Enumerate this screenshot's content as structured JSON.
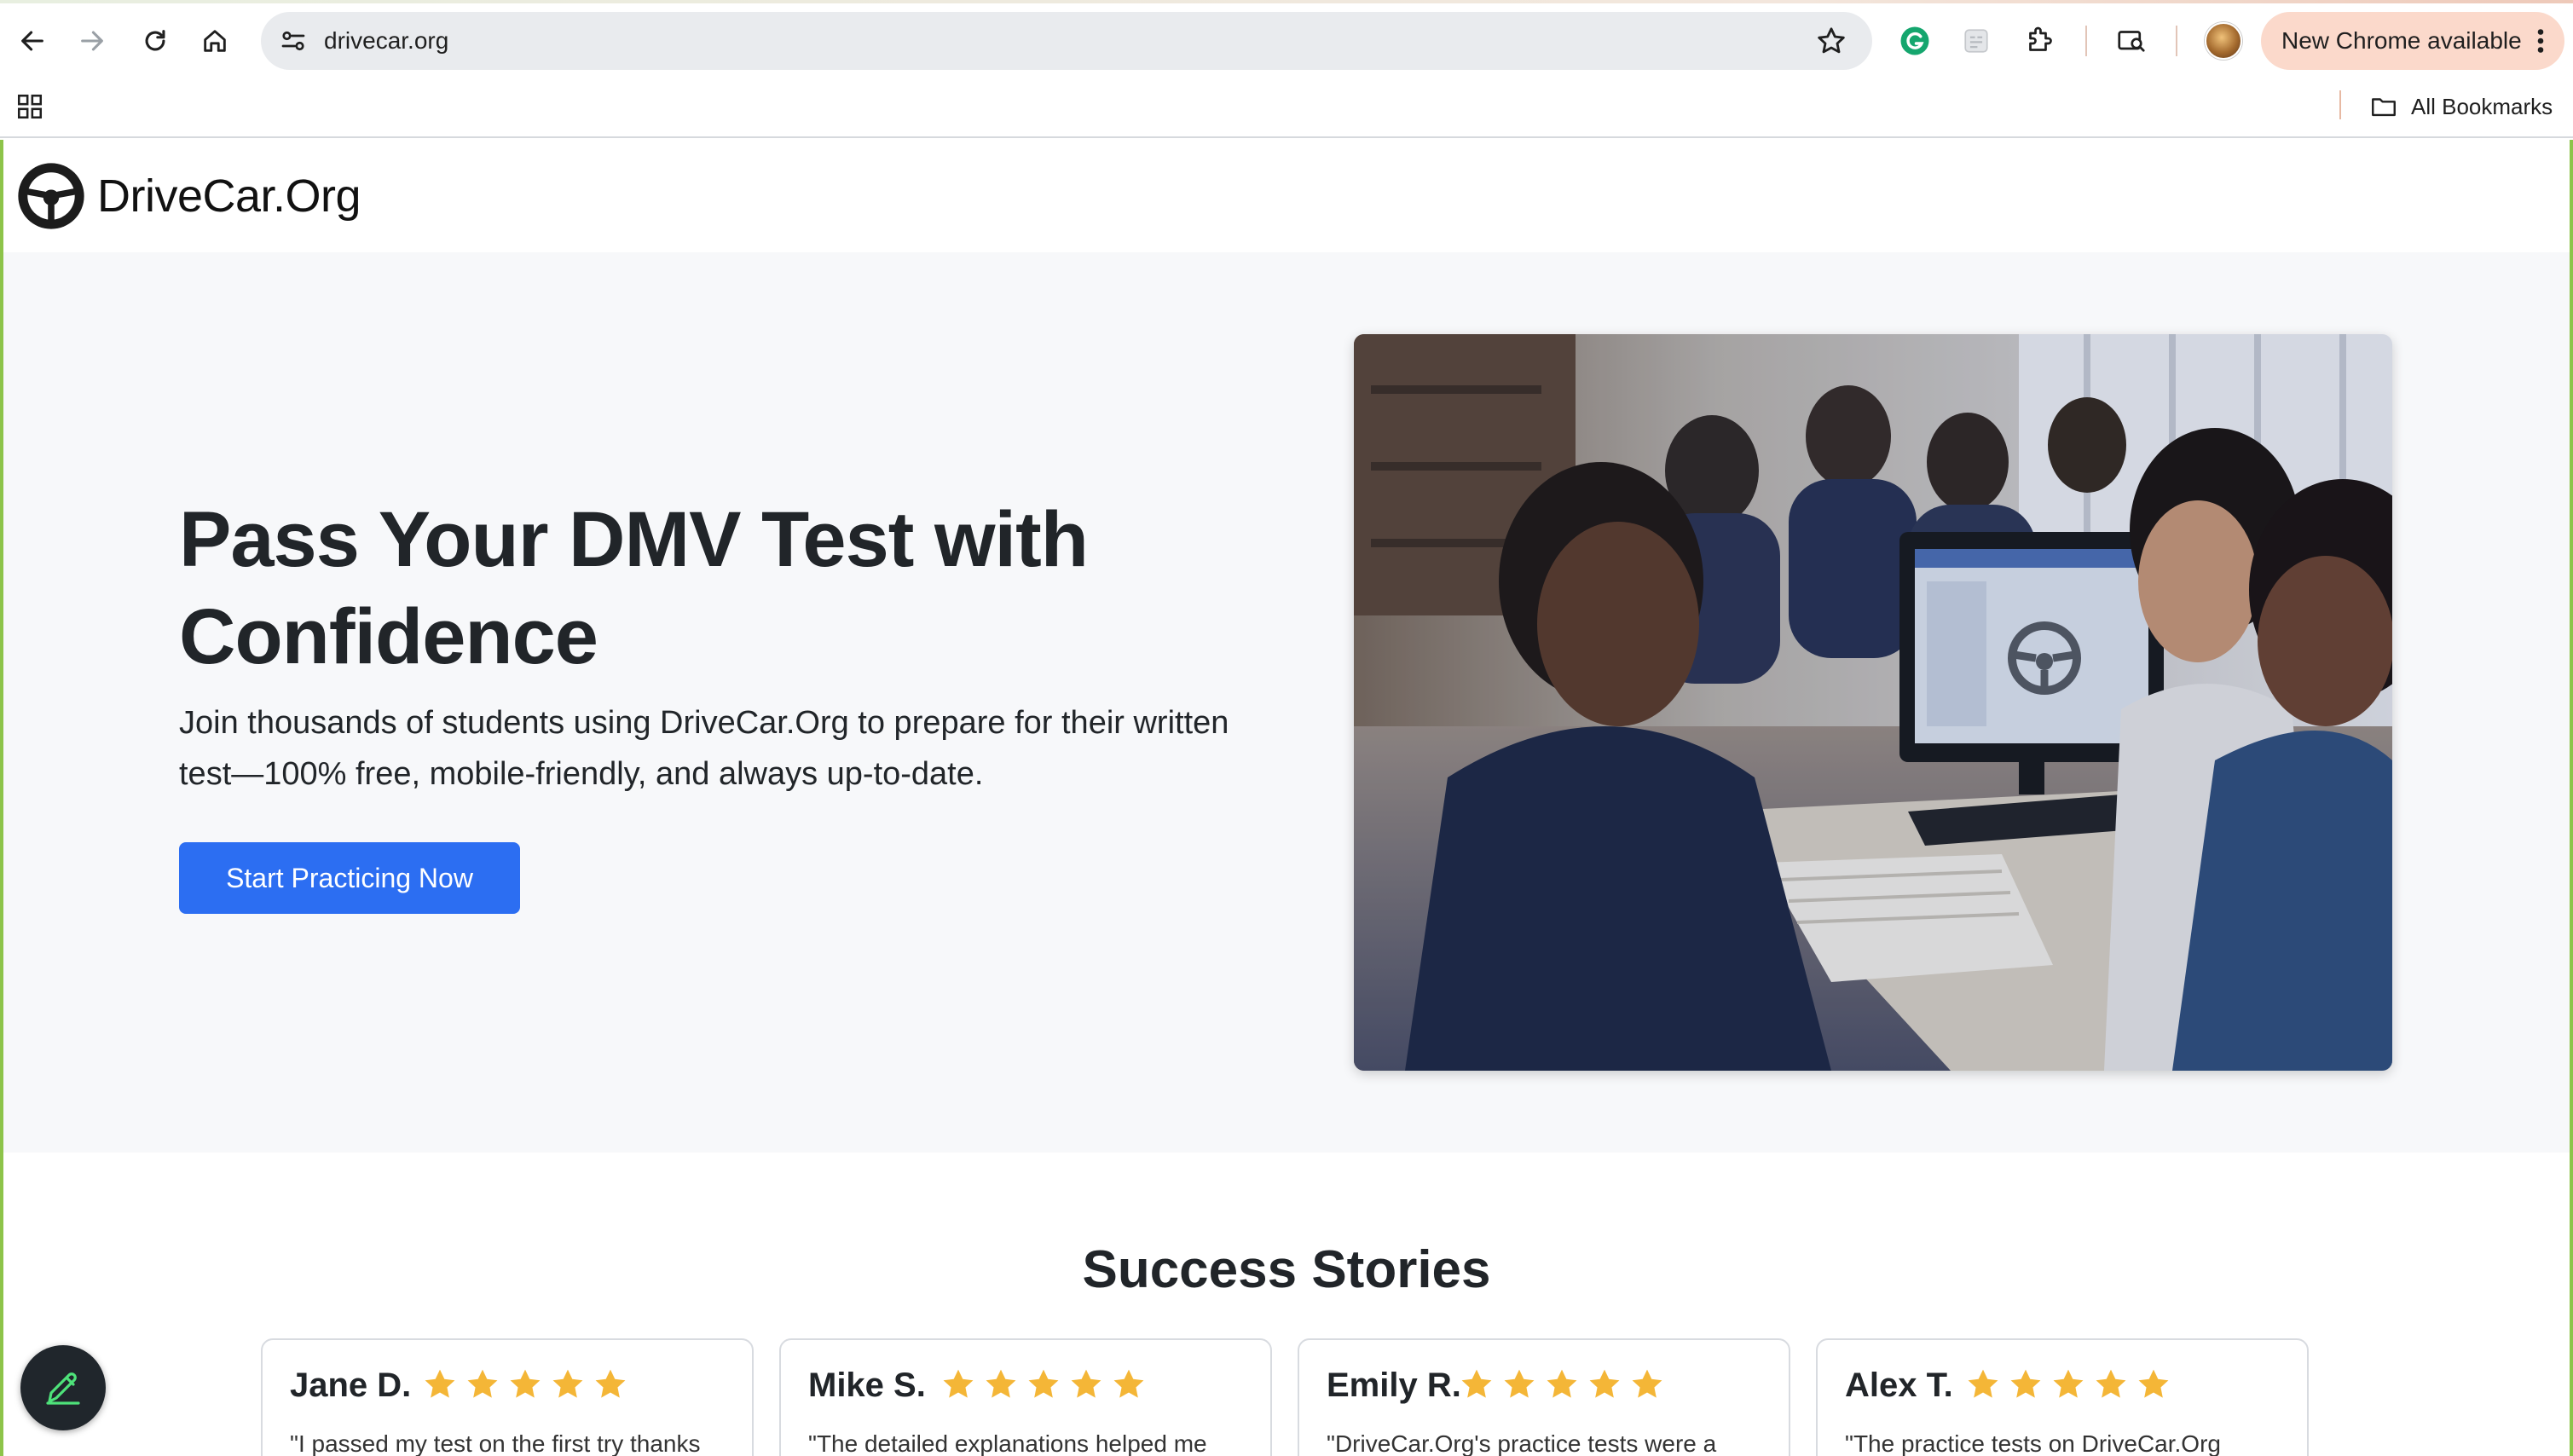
{
  "browser": {
    "url": "drivecar.org",
    "update_label": "New Chrome available",
    "bookmarks_label": "All Bookmarks"
  },
  "site": {
    "logo_text": "DriveCar.Org"
  },
  "hero": {
    "title": "Pass Your DMV Test with Confidence",
    "subtitle": "Join thousands of students using DriveCar.Org to prepare for their written test—100% free, mobile-friendly, and always up-to-date.",
    "cta_label": "Start Practicing Now",
    "accent_color": "#2c6ef2"
  },
  "stories": {
    "title": "Success Stories",
    "star_color": "#f4b637",
    "items": [
      {
        "name": "Jane D.",
        "rating": 5,
        "quote": "\"I passed my test on the first try thanks"
      },
      {
        "name": "Mike S.",
        "rating": 5,
        "quote": "\"The detailed explanations helped me"
      },
      {
        "name": "Emily R.",
        "rating": 5,
        "quote": "\"DriveCar.Org's practice tests were a"
      },
      {
        "name": "Alex T.",
        "rating": 5,
        "quote": "\"The practice tests on DriveCar.Org"
      }
    ]
  }
}
